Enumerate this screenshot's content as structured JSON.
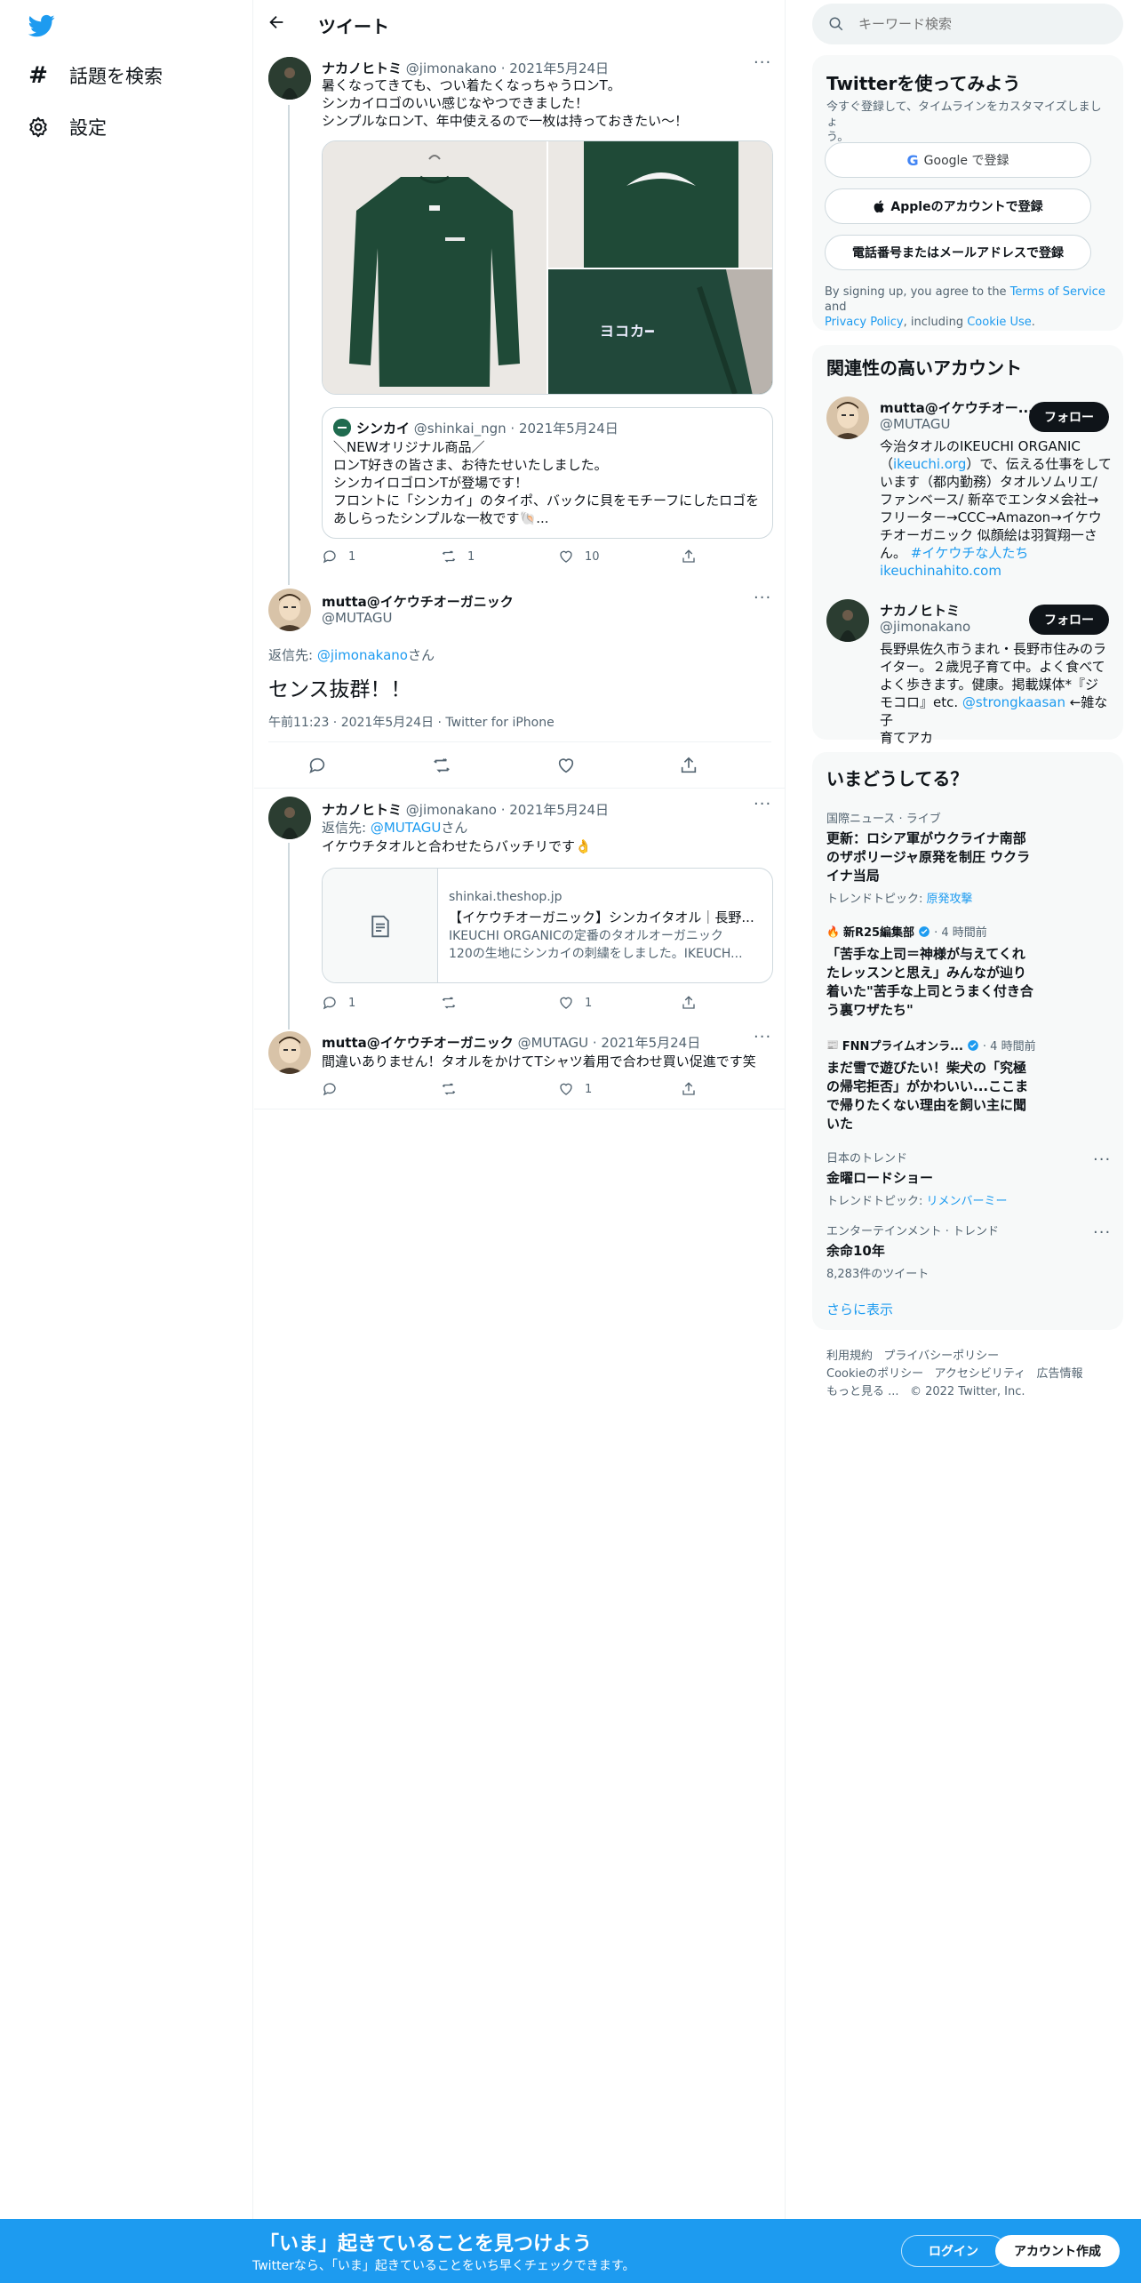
{
  "nav": {
    "explore_label": "話題を検索",
    "settings_label": "設定"
  },
  "header": {
    "title": "ツイート"
  },
  "search": {
    "placeholder": "キーワード検索"
  },
  "tweet1": {
    "name": "ナカノヒトミ",
    "handle": "@jimonakano",
    "date": "2021年5月24日",
    "lines": [
      "暑くなってきても、つい着たくなっちゃうロンT。",
      "シンカイロゴのいい感じなやつできました！",
      "シンプルなロンT、年中使えるので一枚は持っておきたい〜！"
    ],
    "photo_logo_text": "ヨコカ━",
    "quote": {
      "name": "シンカイ",
      "handle": "@shinkai_ngn",
      "date": "2021年5月24日",
      "lines": [
        "＼NEWオリジナル商品／",
        "ロンT好きの皆さま、お待たせいたしました。",
        "シンカイロゴロンTが登場です！",
        "フロントに「シンカイ」のタイポ、バックに貝をモチーフにしたロゴを",
        "あしらったシンプルな一枚です🐚..."
      ]
    },
    "replies": "1",
    "retweets": "1",
    "likes": "10"
  },
  "main_tweet": {
    "name": "mutta@イケウチオーガニック",
    "handle": "@MUTAGU",
    "reply_prefix": "返信先: ",
    "reply_to": "@jimonakano",
    "reply_suffix": "さん",
    "text": "センス抜群！！",
    "meta": "午前11:23 · 2021年5月24日 · Twitter for iPhone"
  },
  "tweet3": {
    "name": "ナカノヒトミ",
    "handle": "@jimonakano",
    "date": "2021年5月24日",
    "reply_prefix": "返信先: ",
    "reply_to": "@MUTAGU",
    "reply_suffix": "さん",
    "text": "イケウチタオルと合わせたらバッチリです👌",
    "card": {
      "domain": "shinkai.theshop.jp",
      "title": "【イケウチオーガニック】シンカイタオル｜長野...",
      "desc_line1": "IKEUCHI ORGANICの定番のタオルオーガニック",
      "desc_line2": "120の生地にシンカイの刺繍をしました。IKEUCH..."
    },
    "replies": "1",
    "likes": "1"
  },
  "tweet4": {
    "name": "mutta@イケウチオーガニック",
    "handle": "@MUTAGU",
    "date": "2021年5月24日",
    "text": "間違いありません！タオルをかけてTシャツ着用で合わせ買い促進です笑",
    "likes": "1"
  },
  "signup": {
    "title": "Twitterを使ってみよう",
    "subtitle_line1": "今すぐ登録して、タイムラインをカスタマイズしましょ",
    "subtitle_line2": "う。",
    "google": "Google で登録",
    "apple": "Appleのアカウントで登録",
    "phone": "電話番号またはメールアドレスで登録",
    "terms_1": "By signing up, you agree to the ",
    "terms_tos": "Terms of Service",
    "terms_2": " and",
    "terms_privacy": "Privacy Policy",
    "terms_3": ", including ",
    "terms_cookie": "Cookie Use",
    "terms_4": "."
  },
  "relevant": {
    "title": "関連性の高いアカウント",
    "follow_label": "フォロー",
    "accounts": [
      {
        "name": "mutta@イケウチオー...",
        "handle": "@MUTAGU",
        "bio_l1": "今治タオルのIKEUCHI ORGANIC",
        "bio_l2a": "（",
        "bio_l2link": "ikeuchi.org",
        "bio_l2b": "）で、伝える仕事をして",
        "bio_l3": "います（都内勤務）タオルソムリエ/",
        "bio_l4": "ファンベース/ 新卒でエンタメ会社→",
        "bio_l5": "フリーター→CCC→Amazon→イケウ",
        "bio_l6": "チオーガニック 似顔絵は羽賀翔一さ",
        "bio_l7a": "ん。 ",
        "bio_l7link": "#イケウチな人たち",
        "bio_l8link": "ikeuchinahito.com"
      },
      {
        "name": "ナカノヒトミ",
        "handle": "@jimonakano",
        "bio_l1": "長野県佐久市うまれ・長野市住みのラ",
        "bio_l2": "イター。２歳児子育て中。よく食べて",
        "bio_l3": "よく歩きます。健康。掲載媒体*『ジ",
        "bio_l4a": "モコロ』etc. ",
        "bio_l4link": "@strongkaasan",
        "bio_l4b": " ←雑な子",
        "bio_l5": "育てアカ"
      }
    ]
  },
  "trends": {
    "title": "いまどうしてる？",
    "items": [
      {
        "meta": "国際ニュース · ライブ",
        "title_l1": "更新：ロシア軍がウクライナ南部",
        "title_l2": "のザポリージャ原発を制圧 ウクラ",
        "title_l3": "イナ当局",
        "topic_label": "トレンドトピック: ",
        "topic": "原発攻撃"
      },
      {
        "source": "新R25編集部",
        "time": " · 4 時間前",
        "title_l1": "「苦手な上司＝神様が与えてくれ",
        "title_l2": "たレッスンと思え」みんなが辿り",
        "title_l3": "着いた\"苦手な上司とうまく付き合",
        "title_l4": "う裏ワザたち\""
      },
      {
        "source": "FNNプライムオンラ...",
        "time": " · 4 時間前",
        "title_l1": "まだ雪で遊びたい！柴犬の「究極",
        "title_l2": "の帰宅拒否」がかわいい...ここま",
        "title_l3": "で帰りたくない理由を飼い主に聞",
        "title_l4": "いた"
      },
      {
        "meta": "日本のトレンド",
        "title": "金曜ロードショー",
        "topic_label": "トレンドトピック: ",
        "topic": "リメンバーミー"
      },
      {
        "meta": "エンターテインメント · トレンド",
        "title": "余命10年",
        "count": "8,283件のツイート"
      }
    ],
    "show_more": "さらに表示"
  },
  "footer": {
    "terms": "利用規約",
    "privacy": "プライバシーポリシー",
    "cookie": "Cookieのポリシー",
    "accessibility": "アクセシビリティ",
    "ads": "広告情報",
    "more": "もっと見る ...",
    "copyright": "© 2022 Twitter, Inc."
  },
  "bottom": {
    "headline": "「いま」起きていることを見つけよう",
    "sub": "Twitterなら、「いま」起きていることをいち早くチェックできます。",
    "login": "ログイン",
    "signup": "アカウント作成"
  },
  "colors": {
    "brand": "#1d9bf0",
    "text": "#0f1419",
    "muted": "#536471"
  }
}
